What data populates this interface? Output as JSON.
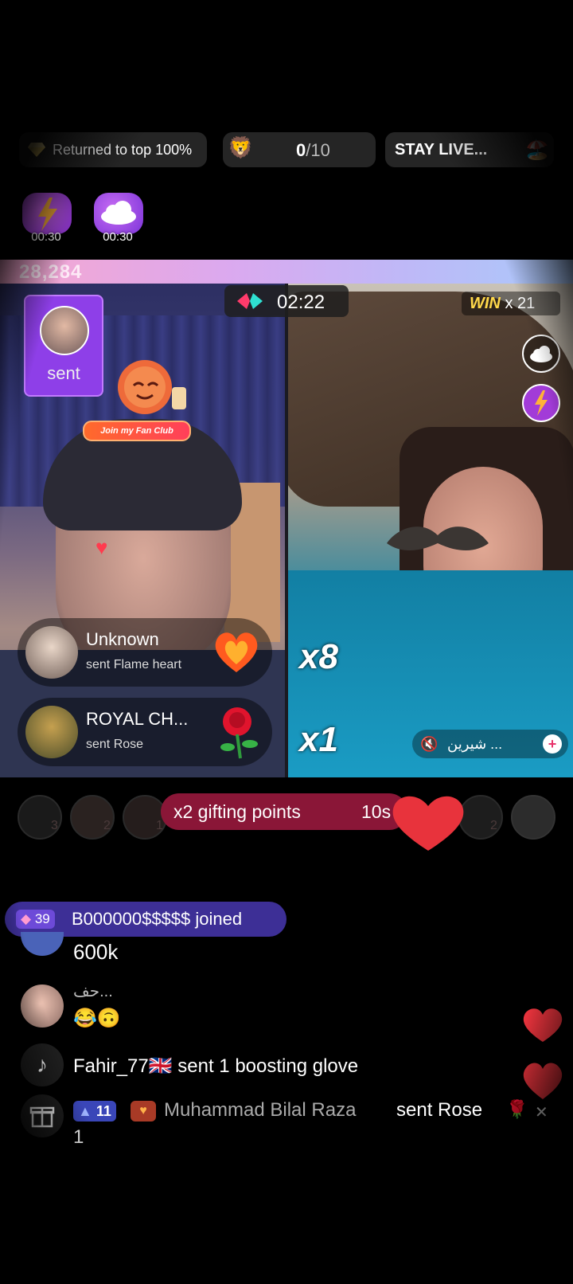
{
  "top_pills": {
    "returned": "Returned to top 100%",
    "progress": "0/10",
    "progress_done": "0",
    "progress_total": "/10",
    "stay_live": "STAY LIVE..."
  },
  "timers": [
    "00:30",
    "00:30"
  ],
  "score": "28,284",
  "battle_timer": "02:22",
  "win_label": "WIN",
  "win_count": "x 21",
  "left_host": {
    "sent_label": "sent",
    "fan_club": "Join my Fan Club"
  },
  "gifts": [
    {
      "name": "Unknown",
      "sub": "sent Flame heart"
    },
    {
      "name": "ROYAL CH...",
      "sub": "sent Rose"
    }
  ],
  "multipliers": {
    "first": "x8",
    "second": "x1"
  },
  "right_host_name": "شيرين ...",
  "gifting_banner": {
    "text": "x2 gifting points",
    "time": "10s"
  },
  "rank_numbers": [
    "3",
    "2",
    "1",
    "2"
  ],
  "join_banner": {
    "level": "39",
    "text": "B000000$$$$$ joined"
  },
  "chat": [
    {
      "text": "600k"
    },
    {
      "name": "حف...",
      "text": "😂🙃"
    },
    {
      "text": "Fahir_77🇬🇧 sent 1 boosting glove"
    },
    {
      "level": "11",
      "name": "Muhammad Bilal Raza",
      "text": "sent Rose",
      "count": "1"
    }
  ],
  "colors": {
    "accent_pink": "#e8336b",
    "gift_banner": "#8a1637",
    "join_banner": "#3d2f96",
    "sent_badge": "#8e3fe8"
  }
}
